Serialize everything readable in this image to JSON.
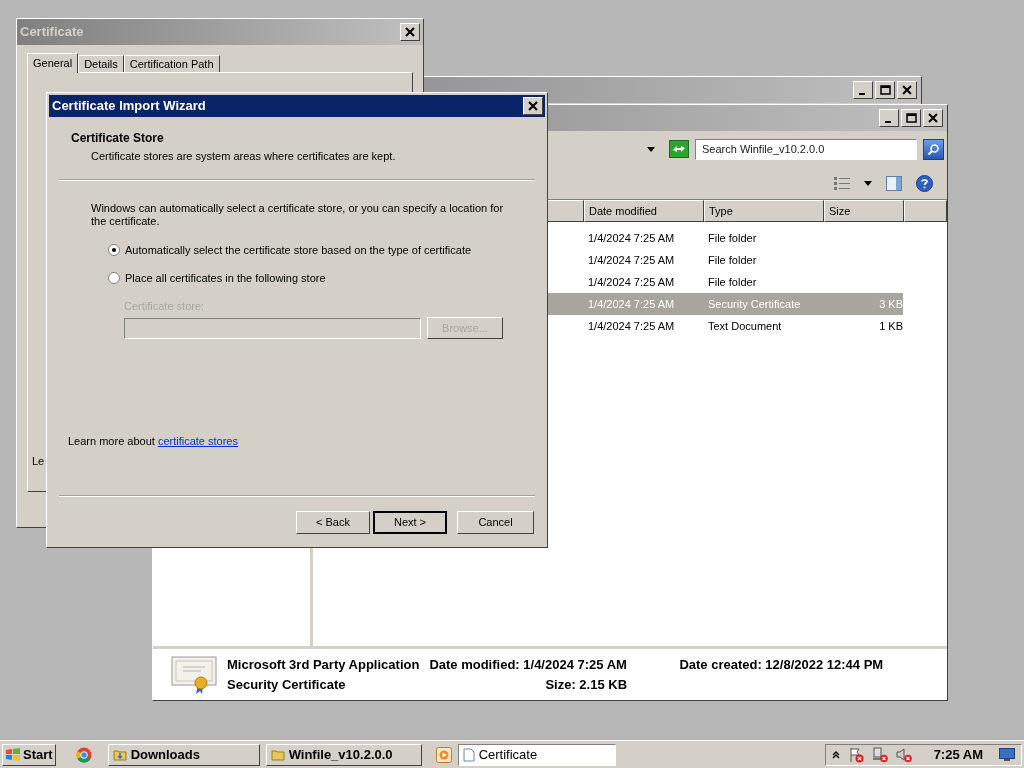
{
  "certificate_window": {
    "title": "Certificate",
    "tabs": [
      {
        "label": "General",
        "selected": true
      },
      {
        "label": "Details",
        "selected": false
      },
      {
        "label": "Certification Path",
        "selected": false
      }
    ],
    "partial_text": "Le"
  },
  "explorer": {
    "search": {
      "placeholder": "Search Winfile_v10.2.0.0"
    },
    "columns": [
      "Date modified",
      "Type",
      "Size"
    ],
    "rows": [
      {
        "date_modified": "1/4/2024 7:25 AM",
        "type": "File folder",
        "selected": false
      },
      {
        "date_modified": "1/4/2024 7:25 AM",
        "type": "File folder",
        "selected": false
      },
      {
        "date_modified": "1/4/2024 7:25 AM",
        "type": "File folder",
        "selected": false
      },
      {
        "date_modified": "1/4/2024 7:25 AM",
        "type": "Security Certificate",
        "size": "3 KB",
        "selected": true
      },
      {
        "date_modified": "1/4/2024 7:25 AM",
        "type": "Text Document",
        "size": "1 KB",
        "selected": false
      }
    ],
    "details": {
      "name": "Microsoft 3rd Party Application",
      "type": "Security Certificate",
      "date_modified": "Date modified: 1/4/2024 7:25 AM",
      "size": "Size: 2.15 KB",
      "date_created": "Date created: 12/8/2022 12:44 PM"
    }
  },
  "wizard": {
    "title": "Certificate Import Wizard",
    "heading": "Certificate Store",
    "subheading": "Certificate stores are system areas where certificates are kept.",
    "intro": "Windows can automatically select a certificate store, or you can specify a location for the certificate.",
    "options": [
      {
        "label": "Automatically select the certificate store based on the type of certificate",
        "selected": true
      },
      {
        "label": "Place all certificates in the following store",
        "selected": false
      }
    ],
    "store": {
      "label": "Certificate store:",
      "browse": "Browse...",
      "disabled": true
    },
    "learn_more": {
      "text": "Learn more about",
      "link": "certificate stores"
    },
    "buttons": [
      {
        "label": "< Back",
        "default": false
      },
      {
        "label": "Next >",
        "default": true
      },
      {
        "label": "Cancel",
        "default": false
      }
    ]
  },
  "taskbar": {
    "start": "Start",
    "items": [
      {
        "label": "Downloads",
        "selected": false
      },
      {
        "label": "Winfile_v10.2.0.0",
        "selected": false
      },
      {
        "label": "Certificate",
        "selected": true
      }
    ],
    "clock": "7:25 AM"
  }
}
